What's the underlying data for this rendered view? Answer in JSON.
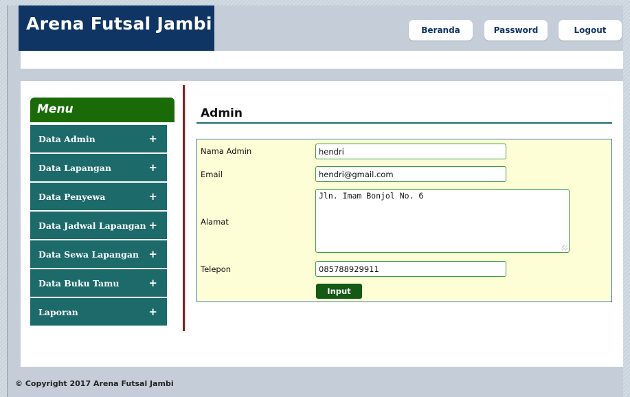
{
  "header": {
    "site_title": "Arena Futsal Jambi",
    "nav": {
      "beranda": "Beranda",
      "password": "Password",
      "logout": "Logout"
    }
  },
  "sidebar": {
    "title": "Menu",
    "items": [
      {
        "label": "Data Admin",
        "expand": "+"
      },
      {
        "label": "Data Lapangan",
        "expand": "+"
      },
      {
        "label": "Data Penyewa",
        "expand": "+"
      },
      {
        "label": "Data Jadwal Lapangan",
        "expand": "+"
      },
      {
        "label": "Data Sewa Lapangan",
        "expand": "+"
      },
      {
        "label": "Data Buku Tamu",
        "expand": "+"
      },
      {
        "label": "Laporan",
        "expand": "+"
      }
    ]
  },
  "main": {
    "title": "Admin",
    "form": {
      "nama_label": "Nama Admin",
      "nama_value": "hendri",
      "email_label": "Email",
      "email_value": "hendri@gmail.com",
      "alamat_label": "Alamat",
      "alamat_value": "Jln. Imam Bonjol No. 6",
      "telepon_label": "Telepon",
      "telepon_value": "085788929911",
      "submit_label": "Input"
    }
  },
  "footer": {
    "copyright": "© Copyright 2017 Arena Futsal Jambi"
  },
  "colors": {
    "header_bg": "#0f3565",
    "menu_title_bg": "#1a6b07",
    "menu_item_bg": "#1d6a6b",
    "divider": "#9b1515",
    "form_bg": "#fefed6",
    "button_bg": "#145a14"
  }
}
